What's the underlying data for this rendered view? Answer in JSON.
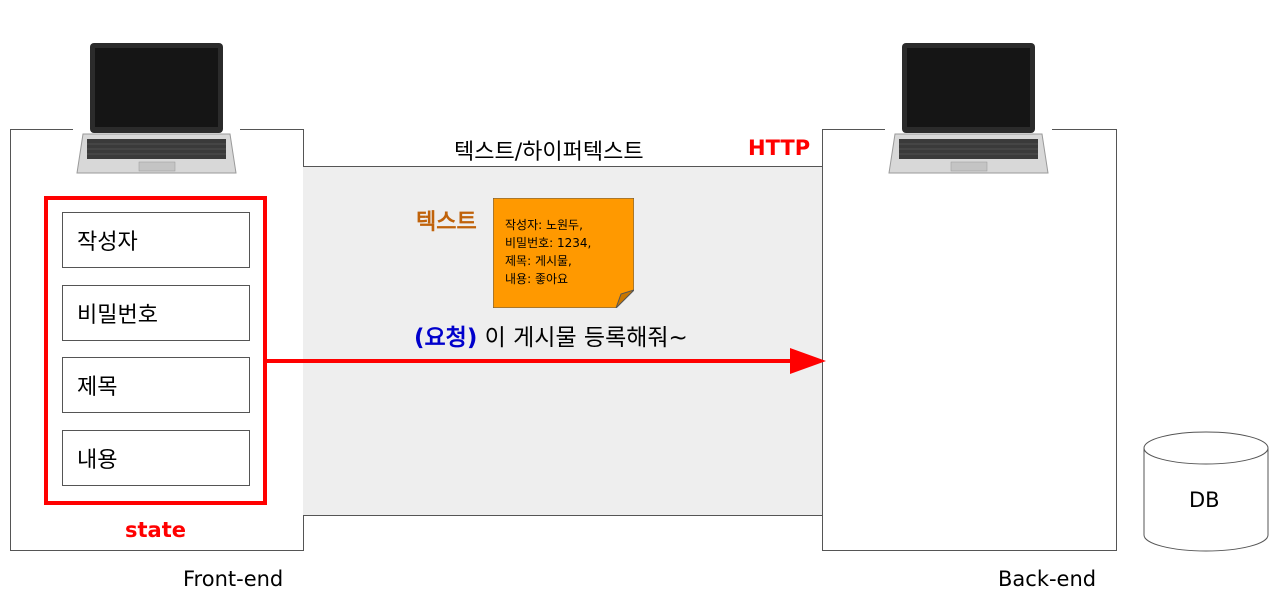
{
  "colors": {
    "accent": "#ff0000",
    "note": "#ff9900",
    "request": "#0000cc",
    "text_label": "#c0620a",
    "channel": "#eeeeee"
  },
  "frontend": {
    "label": "Front-end",
    "state_label": "state",
    "fields": [
      {
        "label": "작성자"
      },
      {
        "label": "비밀번호"
      },
      {
        "label": "제목"
      },
      {
        "label": "내용"
      }
    ]
  },
  "backend": {
    "label": "Back-end"
  },
  "channel": {
    "title": "텍스트/하이퍼텍스트",
    "protocol": "HTTP",
    "text_label": "텍스트",
    "note_lines": [
      "작성자: 노원두,",
      "비밀번호: 1234,",
      "제목: 게시물,",
      "내용: 좋아요"
    ],
    "request_tag": "(요청)",
    "request_text": " 이 게시물 등록해줘~"
  },
  "db": {
    "label": "DB"
  },
  "icons": [
    "laptop-icon",
    "laptop-icon",
    "database-icon",
    "arrow-right-icon",
    "sticky-note-icon"
  ]
}
